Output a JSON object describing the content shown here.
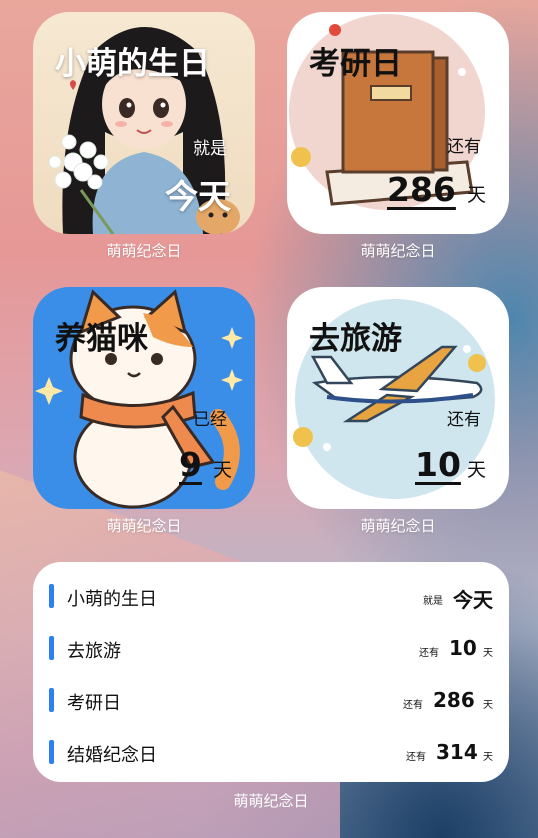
{
  "widgets": [
    {
      "title": "小萌的生日",
      "prefix": "就是",
      "value": "今天",
      "unit": "",
      "caption": "萌萌纪念日",
      "image": "girl-with-flowers-and-cat-illustration"
    },
    {
      "title": "考研日",
      "prefix": "还有",
      "value": "286",
      "unit": "天",
      "caption": "萌萌纪念日",
      "image": "book-illustration"
    },
    {
      "title": "养猫咪",
      "prefix": "已经",
      "value": "9",
      "unit": "天",
      "caption": "萌萌纪念日",
      "image": "cat-with-scarf-illustration"
    },
    {
      "title": "去旅游",
      "prefix": "还有",
      "value": "10",
      "unit": "天",
      "caption": "萌萌纪念日",
      "image": "airplane-illustration"
    }
  ],
  "list_widget": {
    "caption": "萌萌纪念日",
    "rows": [
      {
        "name": "小萌的生日",
        "prefix": "就是",
        "value": "今天",
        "unit": ""
      },
      {
        "name": "去旅游",
        "prefix": "还有",
        "value": "10",
        "unit": "天"
      },
      {
        "name": "考研日",
        "prefix": "还有",
        "value": "286",
        "unit": "天"
      },
      {
        "name": "结婚纪念日",
        "prefix": "还有",
        "value": "314",
        "unit": "天"
      }
    ]
  },
  "colors": {
    "accent_bar": "#2f7ff3",
    "cat_tile_bg": "#3b8ee8"
  }
}
